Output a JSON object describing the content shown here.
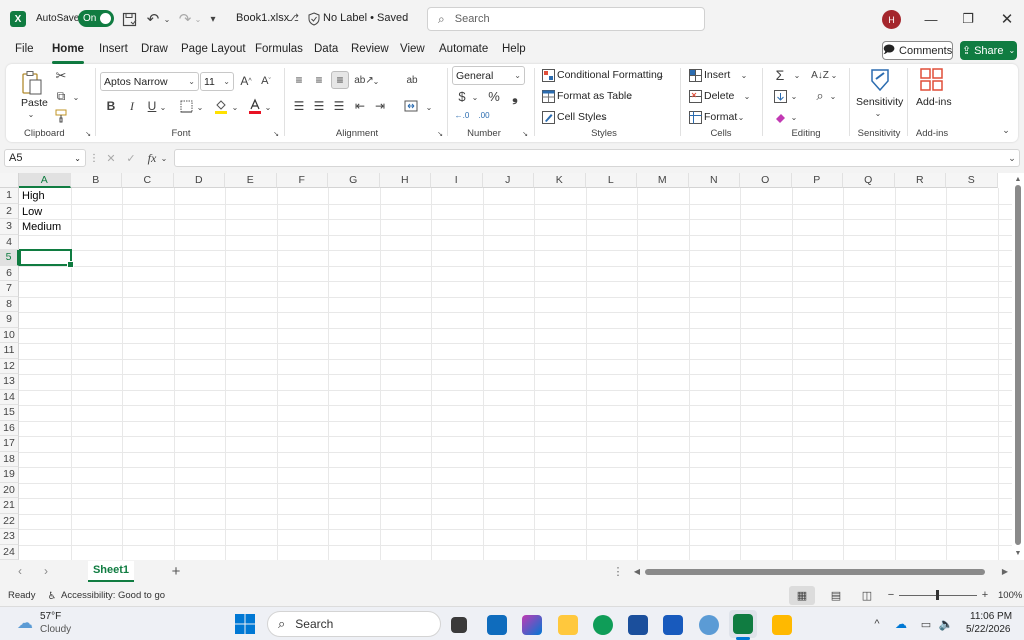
{
  "titlebar": {
    "autosave_label": "AutoSave",
    "autosave_state": "On",
    "filename": "Book1.xlsx",
    "label_status": "No Label • Saved",
    "search_placeholder": "Search",
    "avatar_initial": "H"
  },
  "menu": {
    "tabs": [
      "File",
      "Home",
      "Insert",
      "Draw",
      "Page Layout",
      "Formulas",
      "Data",
      "Review",
      "View",
      "Automate",
      "Help"
    ],
    "active": "Home",
    "comments_label": "Comments",
    "share_label": "Share"
  },
  "ribbon": {
    "clipboard": {
      "paste": "Paste",
      "group": "Clipboard"
    },
    "font": {
      "font_name": "Aptos Narrow",
      "font_size": "11",
      "group": "Font"
    },
    "alignment": {
      "group": "Alignment"
    },
    "number": {
      "format": "General",
      "group": "Number"
    },
    "styles": {
      "conditional": "Conditional Formatting",
      "format_table": "Format as Table",
      "cell_styles": "Cell Styles",
      "group": "Styles"
    },
    "cells": {
      "insert": "Insert",
      "delete": "Delete",
      "format": "Format",
      "group": "Cells"
    },
    "editing": {
      "group": "Editing"
    },
    "sensitivity": {
      "label": "Sensitivity",
      "group": "Sensitivity"
    },
    "addins": {
      "label": "Add-ins",
      "group": "Add-ins"
    }
  },
  "formula_bar": {
    "name_box": "A5",
    "formula": ""
  },
  "grid": {
    "columns": [
      "A",
      "B",
      "C",
      "D",
      "E",
      "F",
      "G",
      "H",
      "I",
      "J",
      "K",
      "L",
      "M",
      "N",
      "O",
      "P",
      "Q",
      "R",
      "S"
    ],
    "rows": [
      "1",
      "2",
      "3",
      "4",
      "5",
      "6",
      "7",
      "8",
      "9",
      "10",
      "11",
      "12",
      "13",
      "14",
      "15",
      "16",
      "17",
      "18",
      "19",
      "20",
      "21",
      "22",
      "23",
      "24"
    ],
    "cells": {
      "A1": "High",
      "A2": "Low",
      "A3": "Medium"
    },
    "selected": "A5"
  },
  "sheets": {
    "tabs": [
      "Sheet1"
    ],
    "active": "Sheet1",
    "add": "+"
  },
  "status": {
    "ready": "Ready",
    "accessibility": "Accessibility: Good to go",
    "zoom": "100%"
  },
  "taskbar": {
    "weather_temp": "57°F",
    "weather_desc": "Cloudy",
    "search": "Search",
    "time": "11:06 PM",
    "date": "5/22/2026"
  },
  "colors": {
    "accent": "#107c41",
    "avatar": "#a4262c"
  }
}
